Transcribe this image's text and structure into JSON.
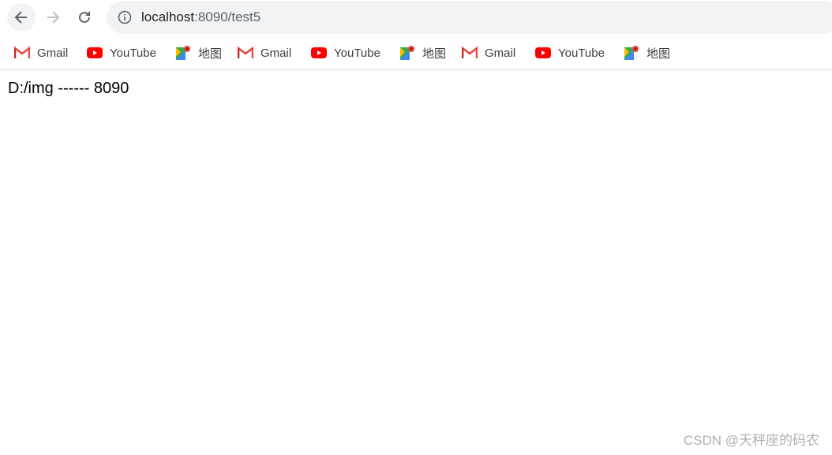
{
  "browser": {
    "url_host": "localhost",
    "url_rest": ":8090/test5",
    "bookmarks": [
      {
        "label": "Gmail",
        "icon": "gmail-icon"
      },
      {
        "label": "YouTube",
        "icon": "youtube-icon"
      },
      {
        "label": "地图",
        "icon": "maps-icon"
      },
      {
        "label": "Gmail",
        "icon": "gmail-icon"
      },
      {
        "label": "YouTube",
        "icon": "youtube-icon"
      },
      {
        "label": "地图",
        "icon": "maps-icon"
      },
      {
        "label": "Gmail",
        "icon": "gmail-icon"
      },
      {
        "label": "YouTube",
        "icon": "youtube-icon"
      },
      {
        "label": "地图",
        "icon": "maps-icon"
      }
    ]
  },
  "page": {
    "text": "D:/img ------ 8090"
  },
  "watermark": "CSDN @天秤座的码农"
}
